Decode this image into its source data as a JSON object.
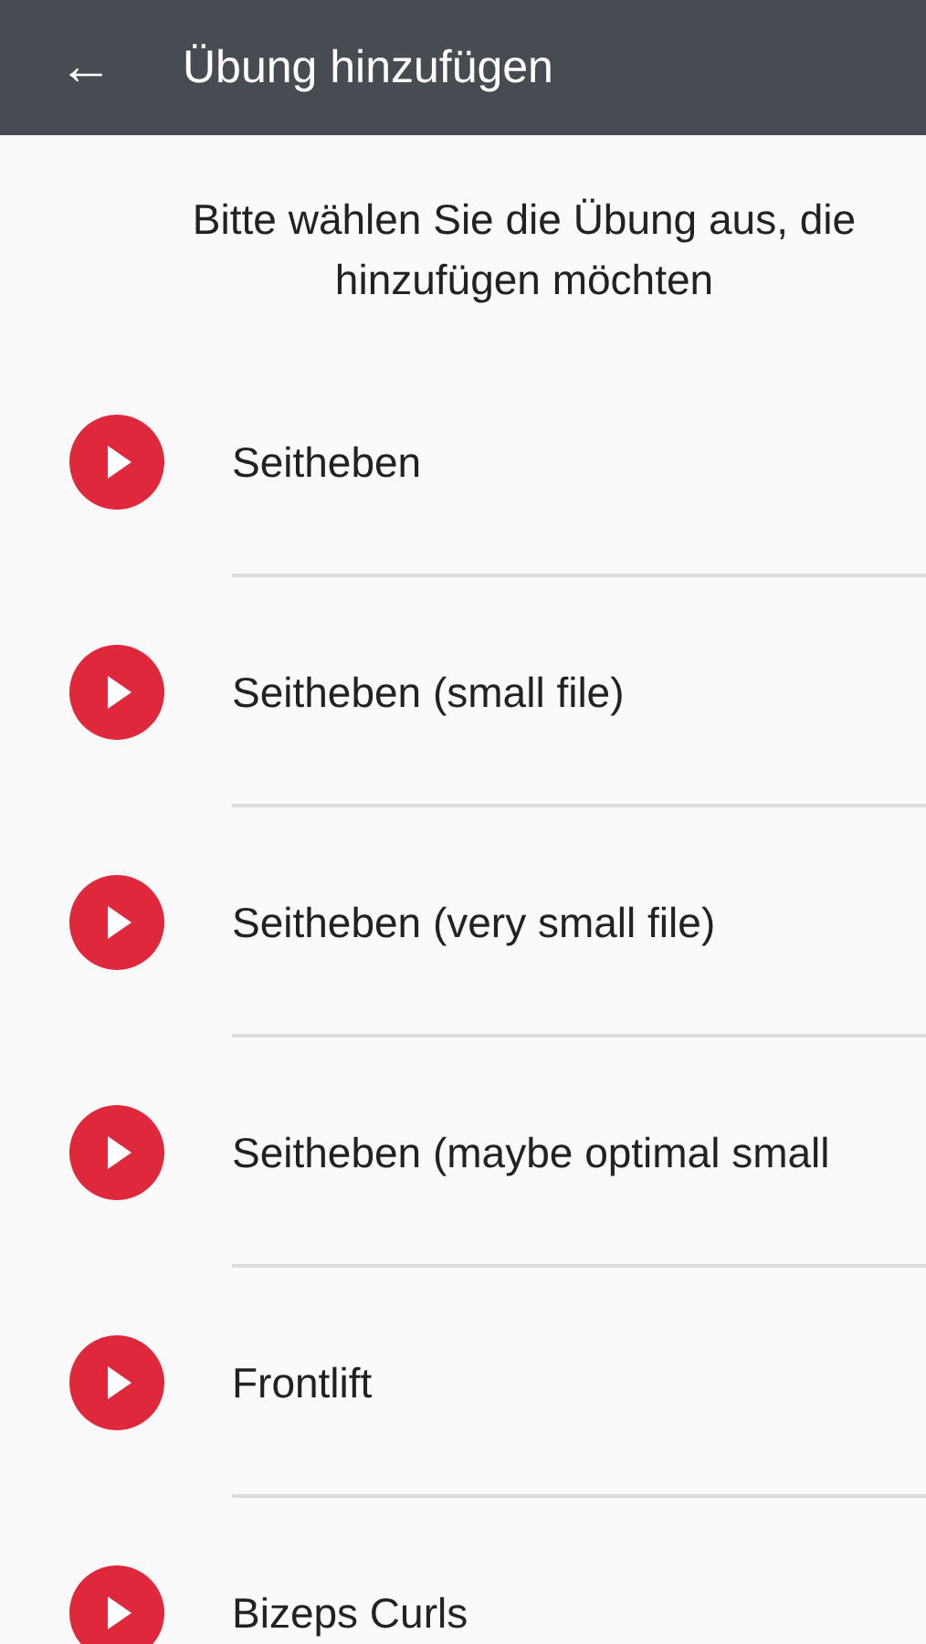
{
  "app_bar": {
    "back_icon": "←",
    "title": "Übung hinzufügen"
  },
  "instruction": "Bitte wählen Sie die Übung aus, die\nhinzufügen möchten",
  "exercises": [
    {
      "name": "Seitheben"
    },
    {
      "name": "Seitheben (small file)"
    },
    {
      "name": "Seitheben (very small file)"
    },
    {
      "name": "Seitheben (maybe optimal small"
    },
    {
      "name": "Frontlift"
    },
    {
      "name": "Bizeps Curls"
    }
  ]
}
